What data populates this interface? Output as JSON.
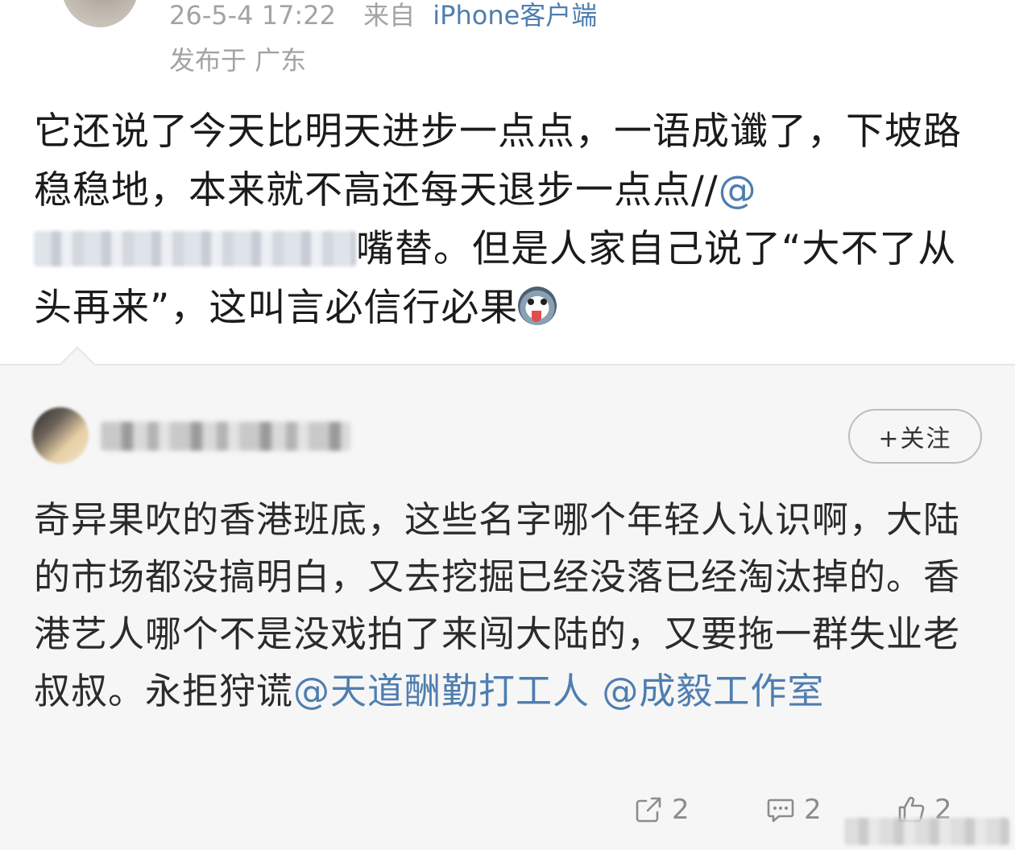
{
  "post": {
    "timestamp": "26-5-4 17:22",
    "source_prefix": "来自",
    "source": "iPhone客户端",
    "location": "发布于 广东",
    "text_part1": "它还说了今天比明天进步一点点，一语成谶了，下坡路稳稳地，本来就不高还每天退步一点点//",
    "mention_at": "@",
    "text_part2": "嘴替。但是人家自己说了“大不了从头再来”，这叫言必信行必果"
  },
  "comment": {
    "follow_label": "+关注",
    "text": "奇异果吹的香港班底，这些名字哪个年轻人认识啊，大陆的市场都没搞明白，又去挖掘已经没落已经淘汰掉的。香港艺人哪个不是没戏拍了来闯大陆的，又要拖一群失业老叔叔。永拒狩谎",
    "mention1": "@天道酬勤打工人",
    "mention2": "@成毅工作室"
  },
  "actions": {
    "share_count": "2",
    "comment_count": "2",
    "like_count": "2"
  },
  "icons": {
    "emoji": "husky-dog-emoji",
    "share": "share-icon",
    "comment": "comment-icon",
    "like": "thumbs-up-icon"
  },
  "colors": {
    "link": "#4f7eb0",
    "meta": "#a3a3a3",
    "comment_bg": "#f6f6f6"
  }
}
